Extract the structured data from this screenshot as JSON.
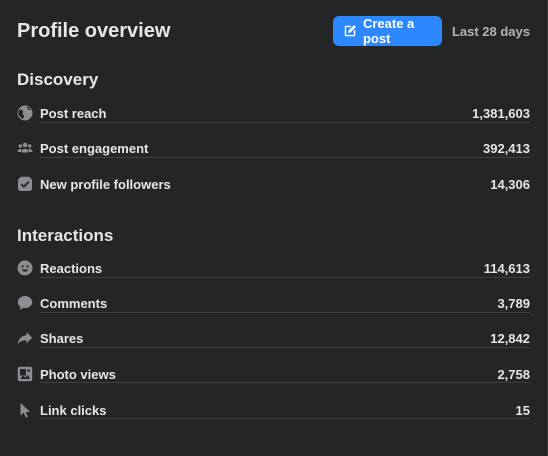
{
  "header": {
    "title": "Profile overview",
    "create_post_label": "Create a post",
    "date_range": "Last 28 days"
  },
  "discovery": {
    "title": "Discovery",
    "items": [
      {
        "label": "Post reach",
        "value": "1,381,603",
        "icon": "globe-icon"
      },
      {
        "label": "Post engagement",
        "value": "392,413",
        "icon": "people-icon"
      },
      {
        "label": "New profile followers",
        "value": "14,306",
        "icon": "follow-check-icon"
      }
    ]
  },
  "interactions": {
    "title": "Interactions",
    "items": [
      {
        "label": "Reactions",
        "value": "114,613",
        "icon": "smiley-icon"
      },
      {
        "label": "Comments",
        "value": "3,789",
        "icon": "comment-bubble-icon"
      },
      {
        "label": "Shares",
        "value": "12,842",
        "icon": "share-arrow-icon"
      },
      {
        "label": "Photo views",
        "value": "2,758",
        "icon": "photo-icon"
      },
      {
        "label": "Link clicks",
        "value": "15",
        "icon": "cursor-icon"
      }
    ]
  },
  "colors": {
    "background": "#242526",
    "accent": "#2d88ff",
    "text": "#e4e6eb",
    "muted": "#b0b3b8",
    "icon": "#8a8d91"
  }
}
